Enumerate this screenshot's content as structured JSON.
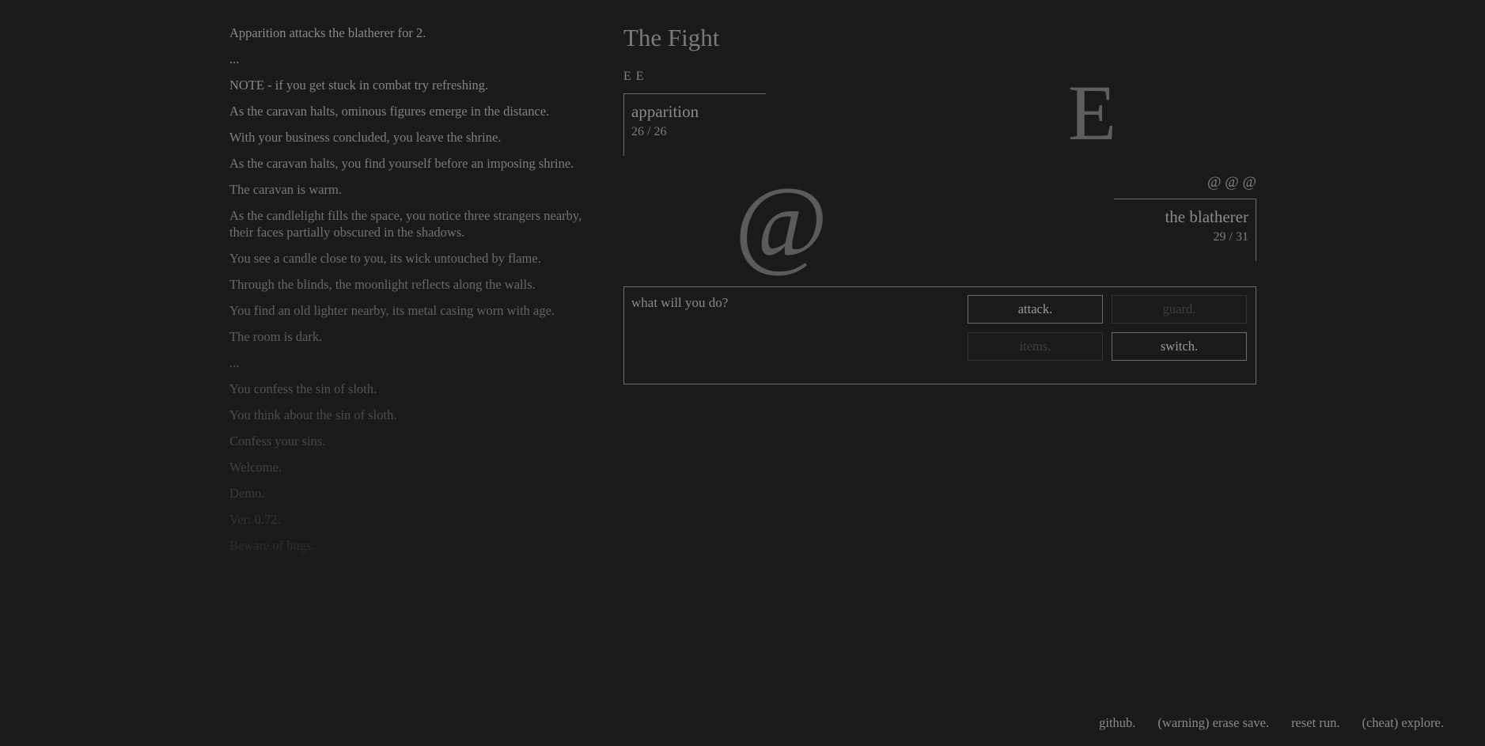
{
  "log": [
    {
      "text": "Apparition attacks the blatherer for 2.",
      "color": "#8a8a8a"
    },
    {
      "text": "...",
      "color": "#888888"
    },
    {
      "text": "NOTE - if you get stuck in combat try refreshing.",
      "color": "#858585"
    },
    {
      "text": "As the caravan halts, ominous figures emerge in the distance.",
      "color": "#828282"
    },
    {
      "text": "With your business concluded, you leave the shrine.",
      "color": "#7f7f7f"
    },
    {
      "text": "As the caravan halts, you find yourself before an imposing shrine.",
      "color": "#7b7b7b"
    },
    {
      "text": "The caravan is warm.",
      "color": "#777777"
    },
    {
      "text": "As the candlelight fills the space, you notice three strangers nearby, their faces partially obscured in the shadows.",
      "color": "#727272"
    },
    {
      "text": "You see a candle close to you, its wick untouched by flame.",
      "color": "#6d6d6d"
    },
    {
      "text": "Through the blinds, the moonlight reflects along the walls.",
      "color": "#686868"
    },
    {
      "text": "You find an old lighter nearby, its metal casing worn with age.",
      "color": "#636363"
    },
    {
      "text": "The room is dark.",
      "color": "#5e5e5e"
    },
    {
      "text": "...",
      "color": "#585858"
    },
    {
      "text": "You confess the sin of sloth.",
      "color": "#525252"
    },
    {
      "text": "You think about the sin of sloth.",
      "color": "#4c4c4c"
    },
    {
      "text": "Confess your sins.",
      "color": "#464646"
    },
    {
      "text": "Welcome.",
      "color": "#404040"
    },
    {
      "text": "Demo.",
      "color": "#3a3a3a"
    },
    {
      "text": "Ver: 0.72.",
      "color": "#343434"
    },
    {
      "text": "Beware of bugs.",
      "color": "#2e2e2e"
    }
  ],
  "fight": {
    "title": "The Fight",
    "ally_party": "E E",
    "ally": {
      "name": "apparition",
      "hp": "26 / 26"
    },
    "enemy_glyph": "E",
    "player_glyph": "@",
    "enemy_party": "@ @ @",
    "enemy": {
      "name": "the blatherer",
      "hp": "29 / 31"
    },
    "prompt": "what will you do?",
    "actions": {
      "attack": "attack.",
      "guard": "guard.",
      "items": "items.",
      "switch": "switch."
    }
  },
  "footer": {
    "github": "github.",
    "erase": "(warning) erase save.",
    "reset": "reset run.",
    "explore": "(cheat) explore."
  }
}
